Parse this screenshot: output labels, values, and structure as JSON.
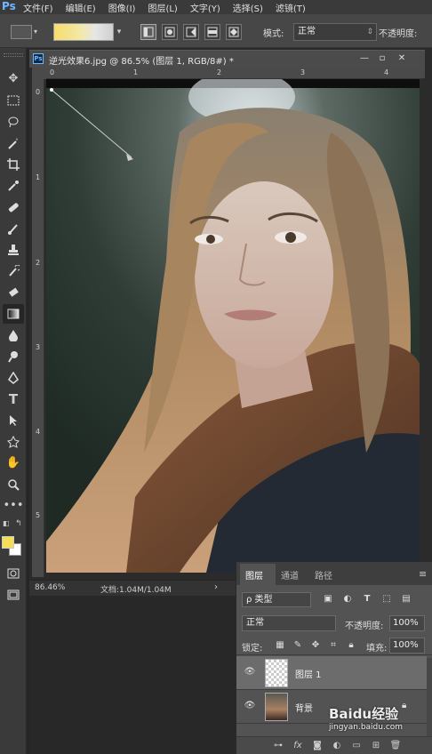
{
  "app": {
    "logo": "Ps"
  },
  "menu": [
    "文件(F)",
    "编辑(E)",
    "图像(I)",
    "图层(L)",
    "文字(Y)",
    "选择(S)",
    "滤镜(T)"
  ],
  "options": {
    "mode_label": "模式:",
    "mode_value": "正常",
    "opacity_label": "不透明度:"
  },
  "document": {
    "title": "逆光效果6.jpg @ 86.5% (图层 1, RGB/8#) *",
    "zoom": "86.46%",
    "doc_size": "文档:1.04M/1.04M",
    "hruler_ticks": [
      "0",
      "1",
      "2",
      "3",
      "4"
    ],
    "vruler_ticks": [
      "0",
      "1",
      "2",
      "3",
      "4",
      "5"
    ]
  },
  "layers_panel": {
    "tabs": [
      "图层",
      "通道",
      "路径"
    ],
    "active_tab": "图层",
    "filter_kind": "ρ 类型",
    "blend_mode": "正常",
    "opacity_label": "不透明度:",
    "opacity_value": "100%",
    "lock_label": "锁定:",
    "fill_label": "填充:",
    "fill_value": "100%",
    "layers": [
      {
        "name": "图层 1",
        "selected": true
      },
      {
        "name": "背景",
        "selected": false,
        "locked": true
      }
    ]
  },
  "watermark": {
    "brand": "Baidu经验",
    "url": "jingyan.baidu.com"
  },
  "colors": {
    "foreground": "#f6dd56",
    "background": "#ffffff",
    "accent": "#6fb7ff"
  }
}
